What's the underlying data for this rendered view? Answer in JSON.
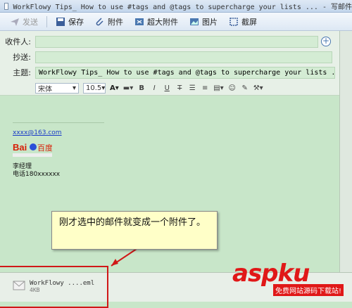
{
  "window": {
    "title": "WorkFlowy Tips_ How to use #tags and @tags to supercharge your lists ... - 写邮件"
  },
  "toolbar": {
    "send": "发送",
    "save": "保存",
    "attach": "附件",
    "large_attach": "超大附件",
    "image": "图片",
    "screenshot": "截屏"
  },
  "fields": {
    "to_label": "收件人:",
    "to_value": "",
    "cc_label": "抄送:",
    "cc_value": "",
    "subject_label": "主题:",
    "subject_value": "WorkFlowy Tips_ How to use #tags and @tags to supercharge your lists ..."
  },
  "format": {
    "font": "宋体",
    "size": "10.5"
  },
  "signature": {
    "email": "xxxx@163.com",
    "logo_text": "Bai百度",
    "name": "李经理",
    "phone": "电话180xxxxxx"
  },
  "callout": {
    "text": "刚才选中的邮件就变成一个附件了。"
  },
  "attachment": {
    "name": "WorkFlowy ....eml",
    "size": "4KB"
  },
  "watermark": {
    "main": "aspku",
    "sub": "免费网站源码下载站!"
  }
}
